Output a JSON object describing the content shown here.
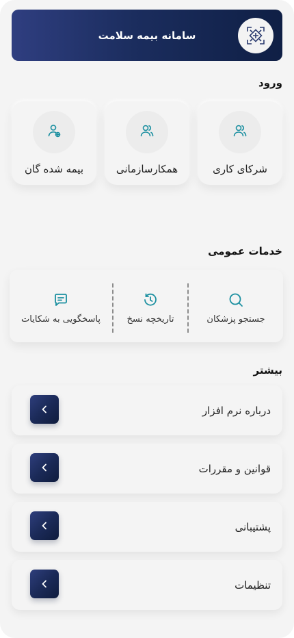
{
  "header": {
    "title": "سامانه بیمه سلامت",
    "logo_icon": "insurance-logo-icon",
    "gradient": [
      "#0f1f45",
      "#2f3e80"
    ]
  },
  "login": {
    "title": "ورود",
    "cards": [
      {
        "label": "شرکای کاری",
        "icon": "users-icon"
      },
      {
        "label": "همکارسازمانی",
        "icon": "users-icon"
      },
      {
        "label": "بیمه شده گان",
        "icon": "user-add-icon"
      }
    ]
  },
  "services": {
    "title": "خدمات عمومی",
    "items": [
      {
        "label": "جستجو پزشکان",
        "icon": "search-icon"
      },
      {
        "label": "تاریخچه نسخ",
        "icon": "history-icon"
      },
      {
        "label": "پاسخگویی به شکایات",
        "icon": "message-icon"
      }
    ]
  },
  "more": {
    "title": "بیشتر",
    "items": [
      {
        "label": "درباره نرم افزار"
      },
      {
        "label": "قوانین و مقررات"
      },
      {
        "label": "پشتیبانی"
      },
      {
        "label": "تنظیمات"
      }
    ]
  },
  "colors": {
    "accent": "#1a8fa0",
    "navy": "#1b2a58",
    "background": "#f4f4f4"
  }
}
